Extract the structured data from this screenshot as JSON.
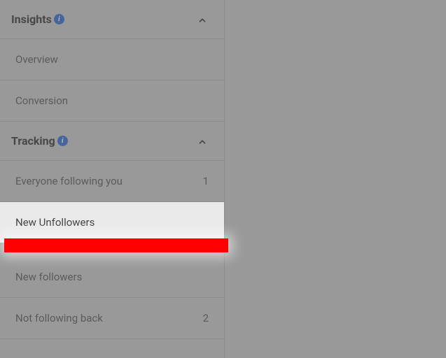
{
  "sidebar": {
    "sections": [
      {
        "title": "Insights",
        "expanded": true,
        "items": [
          {
            "label": "Overview",
            "count": ""
          },
          {
            "label": "Conversion",
            "count": ""
          }
        ]
      },
      {
        "title": "Tracking",
        "expanded": true,
        "items": [
          {
            "label": "Everyone following you",
            "count": "1"
          },
          {
            "label": "New Unfollowers",
            "count": "",
            "highlighted": true
          },
          {
            "label": "New followers",
            "count": ""
          },
          {
            "label": "Not following back",
            "count": "2"
          }
        ]
      }
    ]
  }
}
